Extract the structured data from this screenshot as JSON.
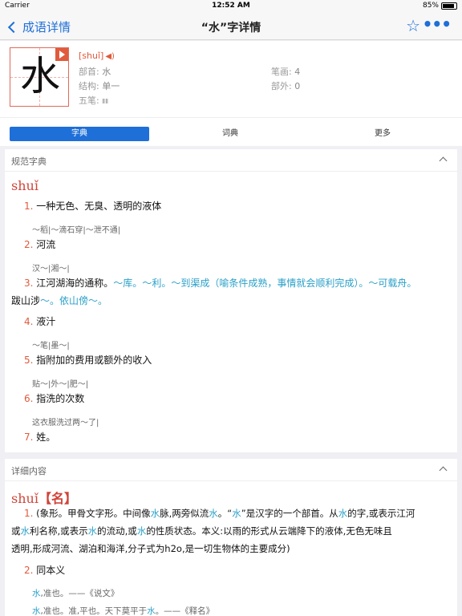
{
  "status_bar": {
    "carrier": "Carrier",
    "time": "12:52 AM",
    "battery": "85%",
    "battery_level": 0.85
  },
  "nav": {
    "back_label": "成语详情",
    "title": "“水”字详情"
  },
  "header": {
    "character": "水",
    "pinyin": "[shuǐ]",
    "radical_label": "部首:",
    "radical": "水",
    "strokes_label": "笔画:",
    "strokes": "4",
    "structure_label": "结构:",
    "structure": "单一",
    "outside_label": "部外:",
    "outside": "0",
    "wubi_label": "五笔:",
    "wubi": "ⅡⅡ"
  },
  "tabs": [
    {
      "label": "字典",
      "active": true
    },
    {
      "label": "词典",
      "active": false
    },
    {
      "label": "更多",
      "active": false
    }
  ],
  "standard_section": {
    "title": "规范字典",
    "pinyin": "shuǐ",
    "definitions": [
      {
        "num": "1.",
        "text": "一种无色、无臭、透明的液体",
        "example": "～稻|～滴石穿|～泄不通|"
      },
      {
        "num": "2.",
        "text": "河流",
        "example": "汉～|湘～|"
      },
      {
        "num": "3.",
        "text_line1": "江河湖海的通称。",
        "text_line1b": "～库。",
        "text_line1c": "～利。",
        "text_line1d": "～到渠成（喻条件成熟，事情就会顺利完成）。",
        "text_line1e": "～可载舟。",
        "text_line2": "跋山涉",
        "text_line2b": "～。依山傍",
        "text_line2c": "～。"
      },
      {
        "num": "4.",
        "text": "液汁",
        "example": "～笔|墨～|"
      },
      {
        "num": "5.",
        "text": "指附加的费用或额外的收入",
        "example": "贴～|外～|肥～|"
      },
      {
        "num": "6.",
        "text": "指洗的次数",
        "example": "这衣服洗过两～了|"
      },
      {
        "num": "7.",
        "text": "姓。"
      }
    ]
  },
  "detail_section": {
    "title": "详细内容",
    "pinyin": "shuǐ",
    "pos": "【名】",
    "def1_num": "1.",
    "def1_a": "(象形。甲骨文字形。中间像",
    "def1_b": "水",
    "def1_c": "脉,两旁似流",
    "def1_d": "水",
    "def1_e": "。“",
    "def1_f": "水",
    "def1_g": "”是汉字的一个部首。从",
    "def1_h": "水",
    "def1_i": "的字,或表示江河",
    "def1_line2_a": "或",
    "def1_line2_b": "水",
    "def1_line2_c": "利名称,或表示",
    "def1_line2_d": "水",
    "def1_line2_e": "的流动,或",
    "def1_line2_f": "水",
    "def1_line2_g": "的性质状态。本义:以雨的形式从云端降下的液体,无色无味且",
    "def1_line3": "透明,形成河流、湖泊和海洋,分子式为h2o,是一切生物体的主要成分)",
    "def2_num": "2.",
    "def2_text": "同本义",
    "quote1_a": "水",
    "quote1_b": ",准也。——《说文》",
    "quote2_a": "水",
    "quote2_b": ",准也。准,平也。天下莫平于",
    "quote2_c": "水",
    "quote2_d": "。——《释名》"
  }
}
